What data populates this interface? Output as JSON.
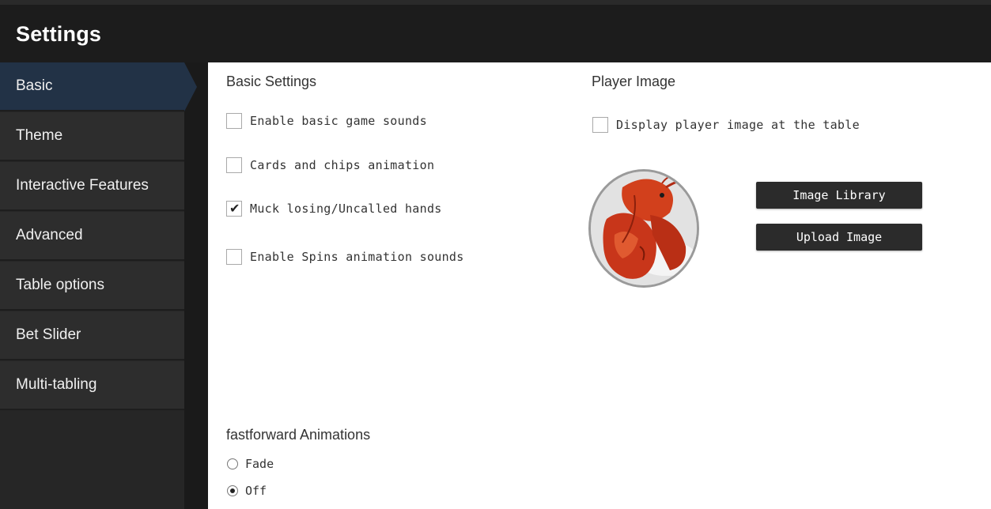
{
  "window": {
    "title": "Settings"
  },
  "sidebar": {
    "items": [
      {
        "label": "Basic",
        "active": true
      },
      {
        "label": "Theme",
        "active": false
      },
      {
        "label": "Interactive Features",
        "active": false
      },
      {
        "label": "Advanced",
        "active": false
      },
      {
        "label": "Table options",
        "active": false
      },
      {
        "label": "Bet Slider",
        "active": false
      },
      {
        "label": "Multi-tabling",
        "active": false
      }
    ]
  },
  "basic_settings": {
    "heading": "Basic Settings",
    "options": [
      {
        "label": "Enable basic game sounds",
        "checked": false
      },
      {
        "label": "Cards and chips animation",
        "checked": false
      },
      {
        "label": "Muck losing/Uncalled hands",
        "checked": true
      },
      {
        "label": "Enable Spins animation sounds",
        "checked": false
      }
    ]
  },
  "player_image": {
    "heading": "Player Image",
    "display_option": {
      "label": "Display player image at the table",
      "checked": false
    },
    "image_library_button": "Image Library",
    "upload_image_button": "Upload Image"
  },
  "fastforward": {
    "heading": "fastforward Animations",
    "options": [
      {
        "label": "Fade",
        "selected": false
      },
      {
        "label": "Off",
        "selected": true
      }
    ]
  },
  "colors": {
    "accent": "#223246",
    "sidebar": "#2d2d2d",
    "titlebar": "#1c1c1c"
  },
  "icons": {
    "checkbox_checked": "checkmark-icon",
    "avatar": "lobster-avatar-image"
  }
}
